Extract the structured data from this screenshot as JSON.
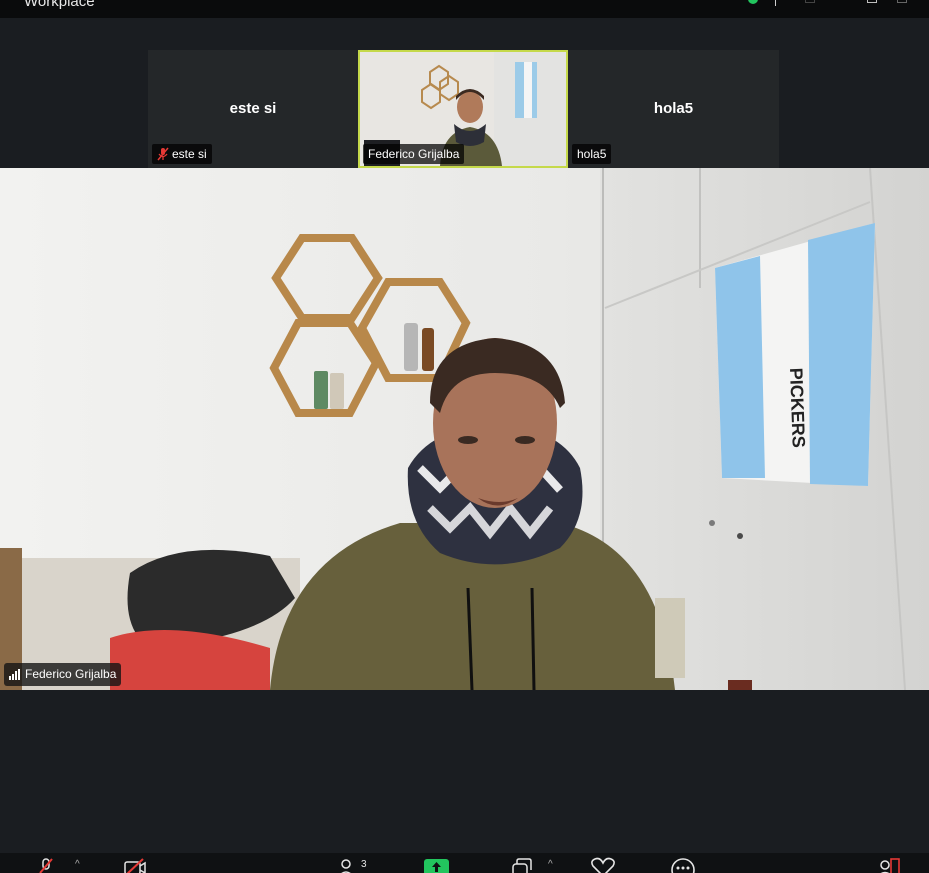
{
  "app": {
    "title": "Workplace"
  },
  "thumbnails": [
    {
      "center_name": "este si",
      "tag_label": "este si",
      "muted": true
    },
    {
      "tag_label": "Federico Grijalba",
      "active": true
    },
    {
      "center_name": "hola5",
      "tag_label": "hola5",
      "muted": false
    }
  ],
  "main": {
    "speaker_label": "Federico Grijalba"
  },
  "toolbar": {
    "participants_count": "3"
  },
  "colors": {
    "active_speaker": "#c5d94a",
    "share_accent": "#22c55e",
    "muted_red": "#e53935",
    "background": "#1a1d21"
  }
}
